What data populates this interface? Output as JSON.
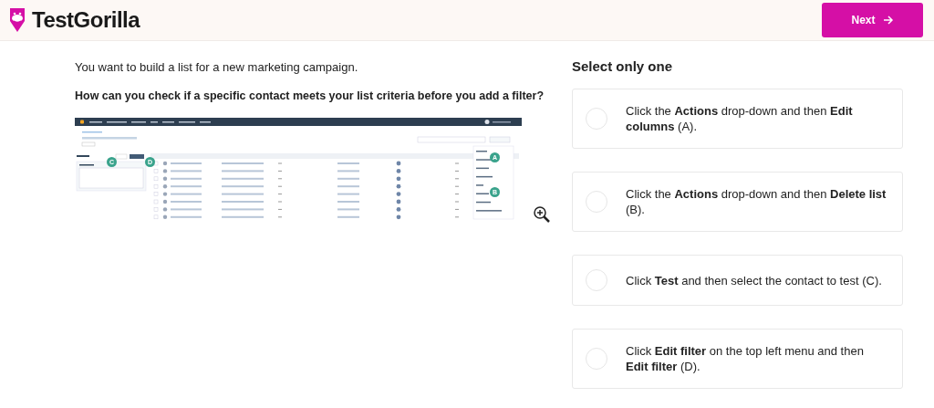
{
  "header": {
    "logo_text": "TestGorilla",
    "next_button": "Next"
  },
  "question": {
    "intro": "You want to build a list for a new marketing campaign.",
    "prompt": "How can you check if a specific contact meets your list criteria before you add a filter?",
    "screenshot": {
      "callouts": [
        {
          "letter": "A"
        },
        {
          "letter": "B"
        },
        {
          "letter": "C"
        },
        {
          "letter": "D"
        }
      ]
    }
  },
  "answers": {
    "instruction": "Select only one",
    "options": [
      {
        "text": "Click the **Actions** drop-down and then **Edit columns** (A).",
        "selected": false
      },
      {
        "text": "Click the **Actions** drop-down and then **Delete list** (B).",
        "selected": false
      },
      {
        "text": "Click **Test** and then select the contact to test (C).",
        "selected": false
      },
      {
        "text": "Click **Edit filter** on the top left menu and then **Edit filter** (D).",
        "selected": false
      }
    ]
  }
}
